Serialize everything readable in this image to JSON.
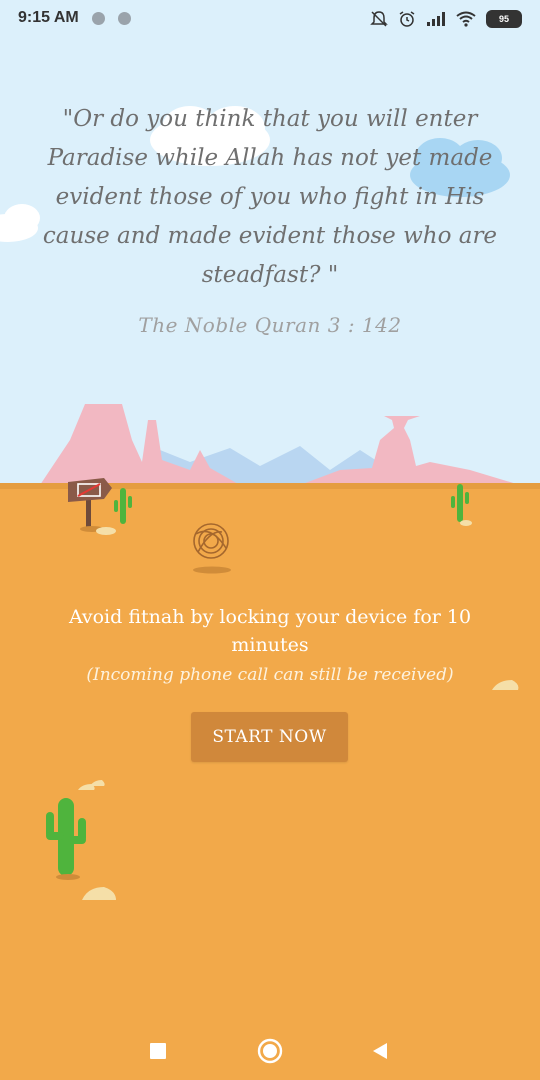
{
  "status_bar": {
    "time": "9:15 AM",
    "battery": "95",
    "icons": [
      "notification-dot-icon",
      "notification-dot-icon",
      "muted-bell-icon",
      "alarm-icon",
      "signal-icon",
      "wifi-icon",
      "battery-icon"
    ]
  },
  "quote": {
    "text": "\"Or do you think that you will enter Paradise while Allah has not yet made evident those of you who fight in His cause and made evident those who are steadfast? \"",
    "reference": "The Noble Quran 3 : 142"
  },
  "message": {
    "main": "Avoid fitnah by locking your device for 10 minutes",
    "sub": "(Incoming phone call can still be received)"
  },
  "start_button": {
    "label": "START NOW"
  },
  "nav_bar": {
    "icons": [
      "recent-apps-icon",
      "home-icon",
      "back-icon"
    ]
  },
  "colors": {
    "sky": "#dcf0fb",
    "sand": "#f2a94a",
    "button": "#d0883b",
    "mountains": "#f2b5c0",
    "cactus": "#4fb43d"
  }
}
